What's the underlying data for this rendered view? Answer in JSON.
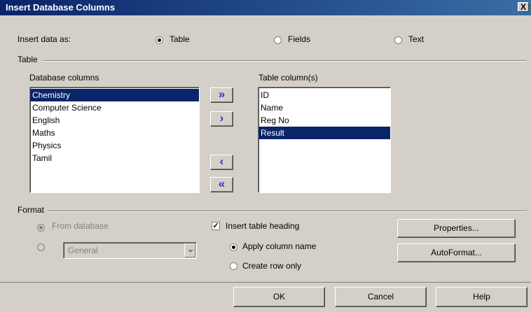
{
  "window": {
    "title": "Insert Database Columns",
    "close_glyph": "X"
  },
  "insert_as": {
    "label": "Insert data as:",
    "options": [
      {
        "label": "Table",
        "selected": true
      },
      {
        "label": "Fields",
        "selected": false
      },
      {
        "label": "Text",
        "selected": false
      }
    ]
  },
  "table_group": {
    "label": "Table",
    "database_columns_label": "Database columns",
    "database_columns": [
      "Chemistry",
      "Computer Science",
      "English",
      "Maths",
      "Physics",
      "Tamil"
    ],
    "database_selected_index": 0,
    "table_columns_label": "Table column(s)",
    "table_columns": [
      "ID",
      "Name",
      "Reg No",
      "Result"
    ],
    "table_selected_index": 3,
    "buttons": {
      "add_all": "»",
      "add_one": "›",
      "remove_one": "‹",
      "remove_all": "«"
    }
  },
  "format_group": {
    "label": "Format",
    "from_database_label": "From database",
    "from_database_selected": true,
    "format_combo_value": "General",
    "insert_heading_label": "Insert table heading",
    "insert_heading_checked": true,
    "apply_column_name_label": "Apply column name",
    "apply_column_name_selected": true,
    "create_row_only_label": "Create row only",
    "properties_button": "Properties...",
    "autoformat_button": "AutoFormat..."
  },
  "footer": {
    "ok": "OK",
    "cancel": "Cancel",
    "help": "Help"
  }
}
